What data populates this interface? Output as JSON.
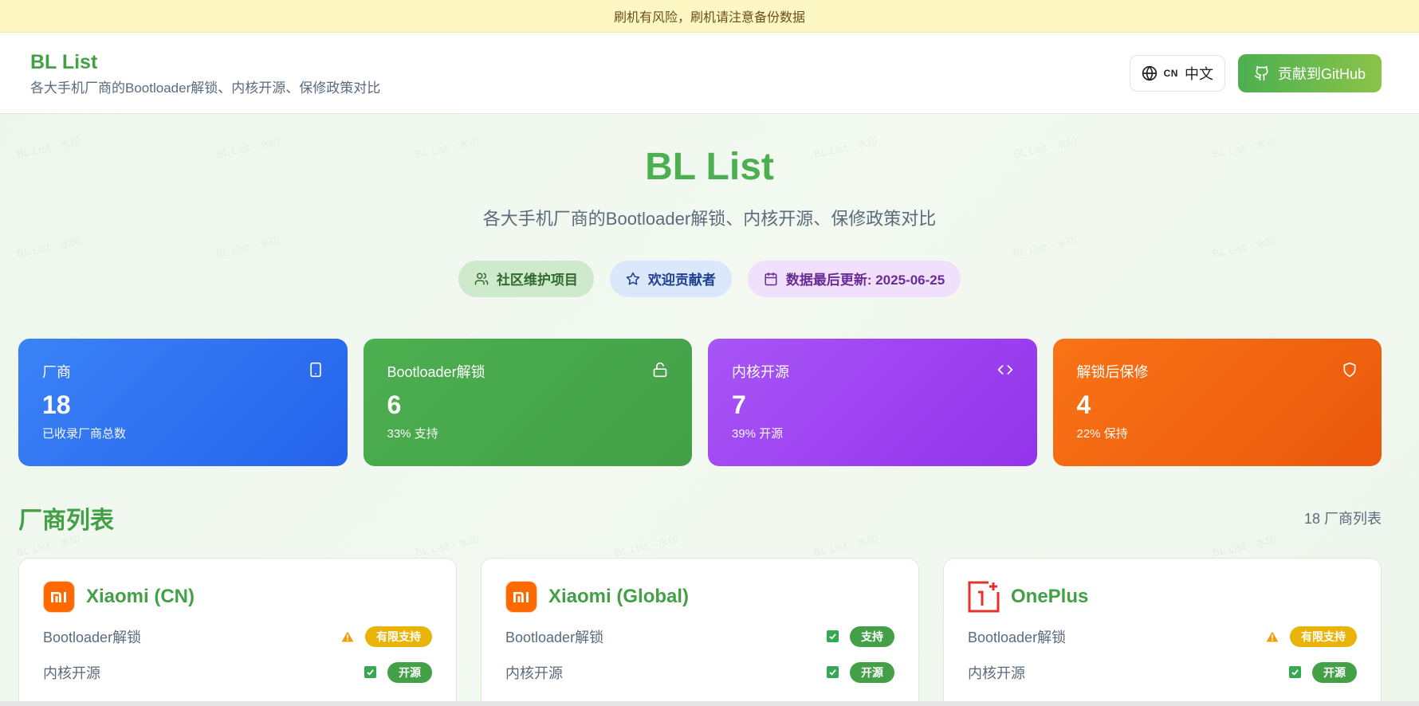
{
  "banner": {
    "text": "刷机有风险，刷机请注意备份数据"
  },
  "header": {
    "title": "BL List",
    "subtitle": "各大手机厂商的Bootloader解锁、内核开源、保修政策对比",
    "lang_code": "CN",
    "lang_label": "中文",
    "github_label": "贡献到GitHub"
  },
  "hero": {
    "title": "BL List",
    "subtitle": "各大手机厂商的Bootloader解锁、内核开源、保修政策对比",
    "badges": [
      {
        "label": "社区维护项目",
        "icon": "users-icon"
      },
      {
        "label": "欢迎贡献者",
        "icon": "star-icon"
      },
      {
        "label": "数据最后更新: 2025-06-25",
        "icon": "calendar-icon"
      }
    ]
  },
  "stats": [
    {
      "label": "厂商",
      "value": "18",
      "desc": "已收录厂商总数",
      "icon": "phone-icon",
      "color": "#2563eb"
    },
    {
      "label": "Bootloader解锁",
      "value": "6",
      "desc": "33% 支持",
      "icon": "unlock-icon",
      "color": "#43a047"
    },
    {
      "label": "内核开源",
      "value": "7",
      "desc": "39% 开源",
      "icon": "code-icon",
      "color": "#9333ea"
    },
    {
      "label": "解锁后保修",
      "value": "4",
      "desc": "22% 保持",
      "icon": "shield-icon",
      "color": "#ea580c"
    }
  ],
  "vendor_list": {
    "title": "厂商列表",
    "count": "18 厂商列表"
  },
  "vendors": [
    {
      "name": "Xiaomi (CN)",
      "logo": "xiaomi-logo",
      "rows": [
        {
          "label": "Bootloader解锁",
          "indicator": "warning-icon",
          "tag": "有限支持",
          "tag_color": "#eab308"
        },
        {
          "label": "内核开源",
          "indicator": "check-icon",
          "tag": "开源",
          "tag_color": "#43a047"
        }
      ]
    },
    {
      "name": "Xiaomi (Global)",
      "logo": "xiaomi-logo",
      "rows": [
        {
          "label": "Bootloader解锁",
          "indicator": "check-icon",
          "tag": "支持",
          "tag_color": "#43a047"
        },
        {
          "label": "内核开源",
          "indicator": "check-icon",
          "tag": "开源",
          "tag_color": "#43a047"
        }
      ]
    },
    {
      "name": "OnePlus",
      "logo": "oneplus-logo",
      "rows": [
        {
          "label": "Bootloader解锁",
          "indicator": "warning-icon",
          "tag": "有限支持",
          "tag_color": "#eab308"
        },
        {
          "label": "内核开源",
          "indicator": "check-icon",
          "tag": "开源",
          "tag_color": "#43a047"
        }
      ]
    }
  ]
}
